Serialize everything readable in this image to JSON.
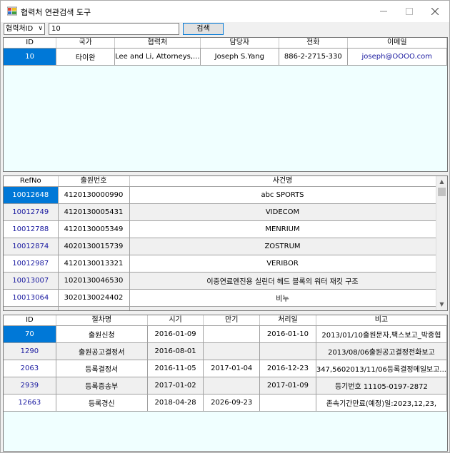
{
  "window": {
    "title": "협력처 연관검색 도구"
  },
  "toolbar": {
    "search_field": "협력처ID",
    "search_value": "10",
    "search_button": "검색"
  },
  "grid1": {
    "headers": [
      "ID",
      "국가",
      "협력처",
      "담당자",
      "전화",
      "이메일"
    ],
    "rows": [
      [
        "10",
        "타이완",
        "Lee and Li, Attorneys,...",
        "Joseph S.Yang",
        "886-2-2715-330",
        "joseph@OOOO.com"
      ]
    ]
  },
  "grid2": {
    "headers": [
      "RefNo",
      "출원번호",
      "사건명"
    ],
    "rows": [
      [
        "10012648",
        "4120130000990",
        "abc SPORTS"
      ],
      [
        "10012749",
        "4120130005431",
        "VIDECOM"
      ],
      [
        "10012788",
        "4120130005349",
        "MENRIUM"
      ],
      [
        "10012874",
        "4020130015739",
        "ZOSTRUM"
      ],
      [
        "10012987",
        "4120130013321",
        "VERIBOR"
      ],
      [
        "10013007",
        "1020130046530",
        "이중연료엔진용 실린더 헤드 블록의 워터 재킷 구조"
      ],
      [
        "10013064",
        "3020130024402",
        "비누"
      ]
    ]
  },
  "grid3": {
    "headers": [
      "ID",
      "절차명",
      "시기",
      "만기",
      "처리일",
      "비고"
    ],
    "rows": [
      [
        "70",
        "출원신청",
        "2016-01-09",
        "",
        "2016-01-10",
        "2013/01/10출원문자,팩스보고_박종협"
      ],
      [
        "1290",
        "출원공고결정서",
        "2016-08-01",
        "",
        "",
        "2013/08/06출원공고결정전화보고"
      ],
      [
        "2063",
        "등록결정서",
        "2016-11-05",
        "2017-01-04",
        "2016-12-23",
        "347,5602013/11/06등록결정메일보고..."
      ],
      [
        "2939",
        "등록증송부",
        "2017-01-02",
        "",
        "2017-01-09",
        "등기번호 11105-0197-2872"
      ],
      [
        "12663",
        "등록경신",
        "2018-04-28",
        "2026-09-23",
        "",
        "존속기간만료(예정)일:2023,12,23,"
      ]
    ]
  }
}
